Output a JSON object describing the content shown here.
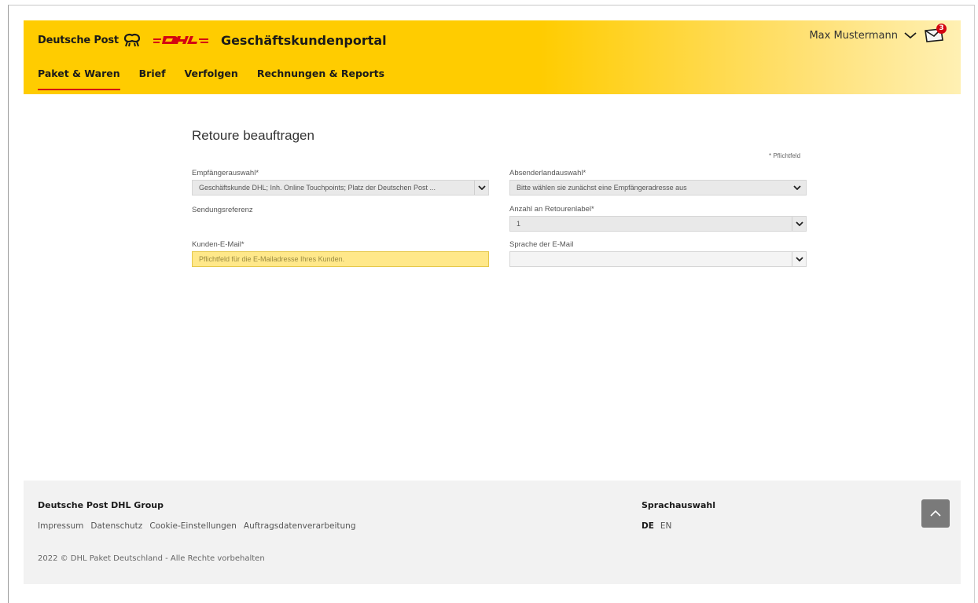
{
  "header": {
    "brand_dp": "Deutsche Post",
    "portal_title": "Geschäftskundenportal",
    "user_name": "Max Mustermann",
    "mail_count": "3",
    "accent": "#ffcc00",
    "dhl_red": "#d40511"
  },
  "nav": [
    {
      "label": "Paket & Waren",
      "active": true
    },
    {
      "label": "Brief"
    },
    {
      "label": "Verfolgen"
    },
    {
      "label": "Rechnungen & Reports"
    }
  ],
  "form": {
    "title": "Retoure beauftragen",
    "required_note": "* Pflichtfeld",
    "empfaenger_label": "Empfängerauswahl*",
    "empfaenger_value": "Geschäftskunde DHL; Inh. Online Touchpoints; Platz der Deutschen Post ...",
    "absenderland_label": "Absenderlandauswahl*",
    "absenderland_value": "Bitte wählen sie zunächst eine Empfängeradresse aus",
    "sendungsreferenz_label": "Sendungsreferenz",
    "anzahl_label": "Anzahl an Retourenlabel*",
    "anzahl_value": "1",
    "kunden_email_label": "Kunden-E-Mail*",
    "kunden_email_placeholder": "Pflichtfeld für die E-Mailadresse Ihres Kunden.",
    "sprache_label": "Sprache der E-Mail",
    "sprache_value": ""
  },
  "footer": {
    "group": "Deutsche Post DHL Group",
    "links": [
      "Impressum",
      "Datenschutz",
      "Cookie-Einstellungen",
      "Auftragsdatenverarbeitung"
    ],
    "copyright": "2022 © DHL Paket Deutschland - Alle Rechte vorbehalten",
    "lang_title": "Sprachauswahl",
    "langs": [
      "DE",
      "EN"
    ]
  }
}
